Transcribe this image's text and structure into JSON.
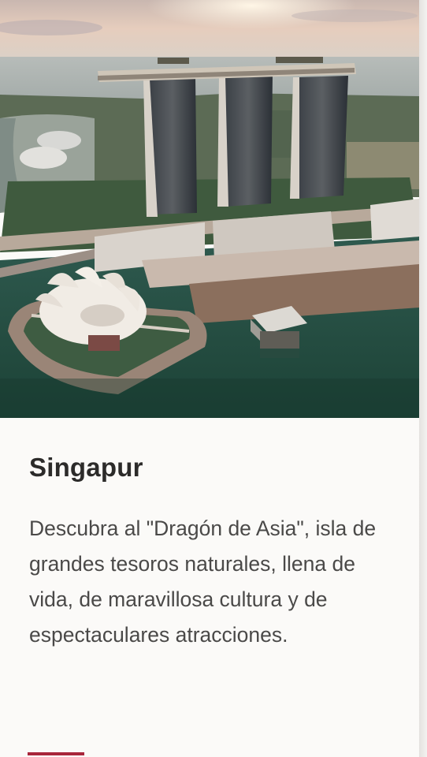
{
  "card": {
    "image_alt": "Marina Bay Sands, Singapur",
    "title": "Singapur",
    "description": "Descubra al \"Dragón de Asia\", isla de grandes tesoros naturales, llena de vida, de maravillosa cultura y de espectaculares atracciones."
  },
  "colors": {
    "background": "#fbfaf8",
    "title_text": "#2c2b2a",
    "body_text": "#4a4948",
    "accent": "#a8253b"
  }
}
